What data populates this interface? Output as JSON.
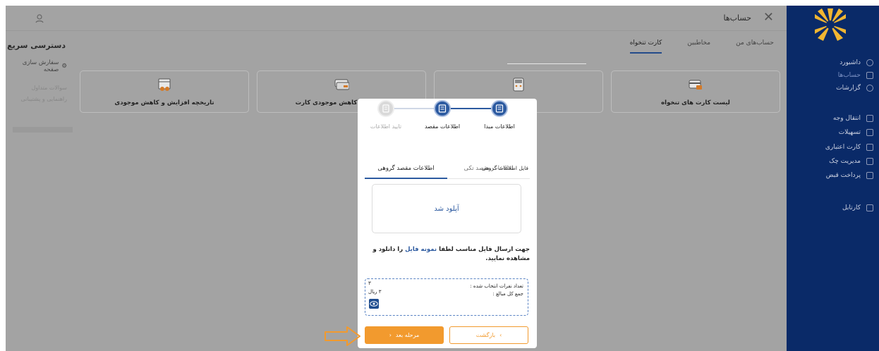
{
  "quick": {
    "top_icon": "user-icon",
    "title": "دسترسی سریع",
    "customize": "سفارش سازی صفحه",
    "faq": "سوالات متداول",
    "support": "راهنمایی و پشتیبانی"
  },
  "header": {
    "title": "حساب‌ها"
  },
  "tabs": [
    "حساب‌های من",
    "مخاطبین",
    "کارت تنخواه"
  ],
  "cards": [
    {
      "label": "لیست کارت های تنخواه",
      "icon": "card-list-icon"
    },
    {
      "label": "",
      "icon": "pos-icon"
    },
    {
      "label": "افزایش و کاهش موجودی کارت",
      "icon": "card-balance-icon"
    },
    {
      "label": "تاریخچه افزایش و کاهش موجودی",
      "icon": "history-icon"
    }
  ],
  "sidebar": {
    "items": [
      {
        "label": "داشبورد",
        "icon": "dashboard-icon"
      },
      {
        "label": "حساب‌ها",
        "icon": "accounts-icon"
      },
      {
        "label": "گزارشات",
        "icon": "reports-icon"
      },
      {
        "label": "انتقال وجه",
        "icon": "transfer-icon"
      },
      {
        "label": "تسهیلات",
        "icon": "facilities-icon"
      },
      {
        "label": "کارت اعتباری",
        "icon": "credit-card-icon"
      },
      {
        "label": "مدیریت چک",
        "icon": "cheque-icon"
      },
      {
        "label": "پرداخت قبض",
        "icon": "bill-icon"
      },
      {
        "label": "کارتابل",
        "icon": "cartable-icon"
      }
    ]
  },
  "modal": {
    "steps": [
      "اطلاعات مبدا",
      "اطلاعات مقصد",
      "تایید اطلاعات"
    ],
    "tabs": [
      "اطلاعات مقصد تکی",
      "اطلاعات مقصد گروهی"
    ],
    "file_label": "فایل اطلاعات گروهی",
    "upload_status": "آپلود شد",
    "hint_before": "جهت ارسال فایل مناسب لطفا",
    "hint_link": "نمونه فایل",
    "hint_after": "را دانلود و مشاهده نمایید.",
    "summary": {
      "count_label": "تعداد نفرات انتخاب شده :",
      "count_value": "۳",
      "total_label": "جمع کل مبالغ :",
      "total_value": "۳ ریال"
    },
    "next_button": "مرحله بعد",
    "back_button": "بازگشت"
  }
}
